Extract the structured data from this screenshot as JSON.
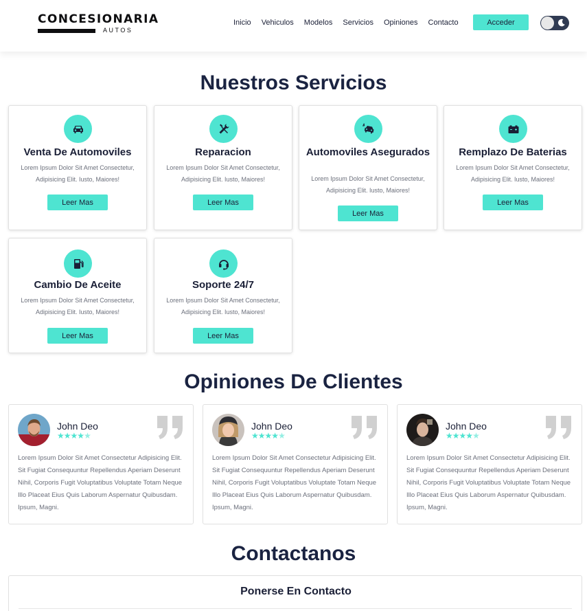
{
  "brand": {
    "name": "CONCESIONARIA",
    "sub": "AUTOS"
  },
  "nav": {
    "items": [
      "Inicio",
      "Vehiculos",
      "Modelos",
      "Servicios",
      "Opiniones",
      "Contacto"
    ],
    "login": "Acceder"
  },
  "colors": {
    "accent": "#4ee4d1",
    "heading": "#1a2341",
    "toggle_bg": "#2f3a52"
  },
  "services": {
    "title": "Nuestros Servicios",
    "items": [
      {
        "icon": "car-icon",
        "title": "Venta De Automoviles",
        "text": "Lorem Ipsum Dolor Sit Amet Consectetur, Adipisicing Elit. Iusto, Maiores!",
        "button": "Leer Mas"
      },
      {
        "icon": "tools-icon",
        "title": "Reparacion",
        "text": "Lorem Ipsum Dolor Sit Amet Consectetur, Adipisicing Elit. Iusto, Maiores!",
        "button": "Leer Mas"
      },
      {
        "icon": "car-crash-icon",
        "title": "Automoviles Asegurados",
        "text": "Lorem Ipsum Dolor Sit Amet Consectetur, Adipisicing Elit. Iusto, Maiores!",
        "button": "Leer Mas"
      },
      {
        "icon": "battery-icon",
        "title": "Remplazo De Baterias",
        "text": "Lorem Ipsum Dolor Sit Amet Consectetur, Adipisicing Elit. Iusto, Maiores!",
        "button": "Leer Mas"
      },
      {
        "icon": "gas-pump-icon",
        "title": "Cambio De Aceite",
        "text": "Lorem Ipsum Dolor Sit Amet Consectetur, Adipisicing Elit. Iusto, Maiores!",
        "button": "Leer Mas"
      },
      {
        "icon": "headset-icon",
        "title": "Soporte 24/7",
        "text": "Lorem Ipsum Dolor Sit Amet Consectetur, Adipisicing Elit. Iusto, Maiores!",
        "button": "Leer Mas"
      }
    ]
  },
  "reviews": {
    "title": "Opiniones De Clientes",
    "items": [
      {
        "name": "John Deo",
        "rating": 4.5,
        "text": "Lorem Ipsum Dolor Sit Amet Consectetur Adipisicing Elit. Sit Fugiat Consequuntur Repellendus Aperiam Deserunt Nihil, Corporis Fugit Voluptatibus Voluptate Totam Neque Illo Placeat Eius Quis Laborum Aspernatur Quibusdam. Ipsum, Magni."
      },
      {
        "name": "John Deo",
        "rating": 4.5,
        "text": "Lorem Ipsum Dolor Sit Amet Consectetur Adipisicing Elit. Sit Fugiat Consequuntur Repellendus Aperiam Deserunt Nihil, Corporis Fugit Voluptatibus Voluptate Totam Neque Illo Placeat Eius Quis Laborum Aspernatur Quibusdam. Ipsum, Magni."
      },
      {
        "name": "John Deo",
        "rating": 4.5,
        "text": "Lorem Ipsum Dolor Sit Amet Consectetur Adipisicing Elit. Sit Fugiat Consequuntur Repellendus Aperiam Deserunt Nihil, Corporis Fugit Voluptatibus Voluptate Totam Neque Illo Placeat Eius Quis Laborum Aspernatur Quibusdam. Ipsum, Magni."
      }
    ]
  },
  "contact": {
    "title": "Contactanos",
    "subtitle": "Ponerse En Contacto"
  }
}
